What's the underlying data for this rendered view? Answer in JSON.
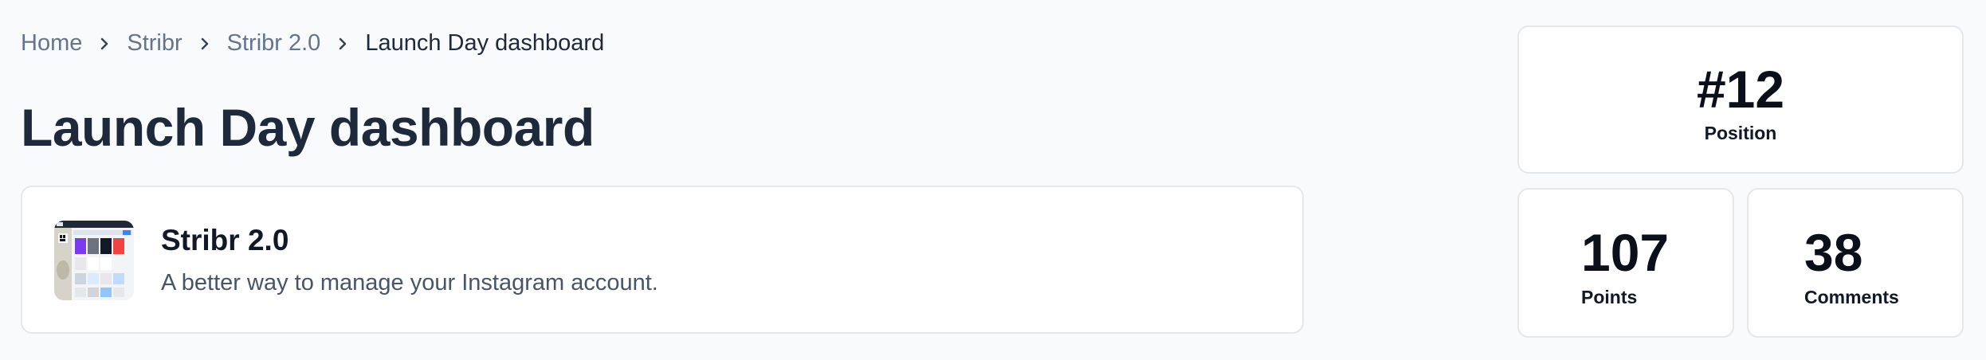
{
  "breadcrumb": {
    "items": [
      {
        "label": "Home"
      },
      {
        "label": "Stribr"
      },
      {
        "label": "Stribr 2.0"
      },
      {
        "label": "Launch Day dashboard"
      }
    ],
    "separator_icon": "chevron-right-icon"
  },
  "page": {
    "title": "Launch Day dashboard"
  },
  "product": {
    "name": "Stribr 2.0",
    "tagline": "A better way to manage your Instagram account.",
    "thumbnail_icon": "product-screenshot-thumbnail"
  },
  "stats": {
    "position": {
      "value": "#12",
      "label": "Position"
    },
    "points": {
      "value": "107",
      "label": "Points"
    },
    "comments": {
      "value": "38",
      "label": "Comments"
    }
  }
}
